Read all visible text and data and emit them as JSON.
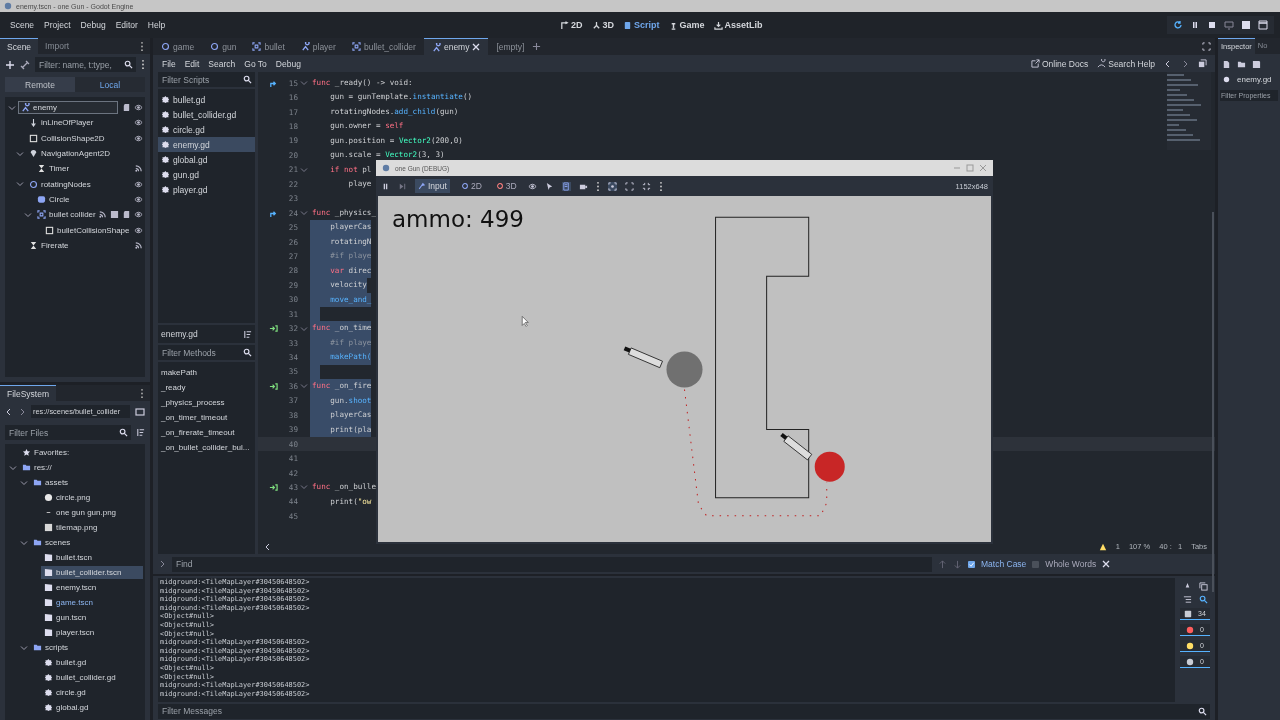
{
  "title_bar": {
    "title": "enemy.tscn - one Gun - Godot Engine"
  },
  "menu": [
    "Scene",
    "Project",
    "Debug",
    "Editor",
    "Help"
  ],
  "workspaces": [
    {
      "label": "2D",
      "kind": "canvas",
      "selected": false
    },
    {
      "label": "3D",
      "kind": "spatial",
      "selected": false
    },
    {
      "label": "Script",
      "kind": "script",
      "selected": true
    },
    {
      "label": "Game",
      "kind": "game",
      "selected": false
    },
    {
      "label": "AssetLib",
      "kind": "assetlib",
      "selected": false
    }
  ],
  "scene_dock": {
    "tabs": [
      {
        "label": "Scene",
        "selected": true
      },
      {
        "label": "Import",
        "selected": false
      }
    ],
    "filter": {
      "placeholder": "Filter: name, t:type,"
    },
    "modes": [
      {
        "label": "Remote",
        "selected": false
      },
      {
        "label": "Local",
        "selected": true
      }
    ],
    "tree": [
      {
        "name": "enemy",
        "kind": "character",
        "selected": true,
        "expanded": true,
        "script": true,
        "visible": true,
        "children": [
          {
            "name": "inLineOfPlayer",
            "kind": "ray",
            "selected": false,
            "visible": true
          },
          {
            "name": "CollisionShape2D",
            "kind": "shape",
            "selected": false,
            "visible": true
          },
          {
            "name": "NavigationAgent2D",
            "kind": "nav",
            "selected": false,
            "expanded": true,
            "children": [
              {
                "name": "Timer",
                "kind": "timer",
                "selected": false,
                "signals": true
              }
            ]
          },
          {
            "name": "rotatingNodes",
            "kind": "node2d",
            "selected": false,
            "expanded": true,
            "visible": true,
            "children": [
              {
                "name": "Circle",
                "kind": "sprite",
                "selected": false,
                "visible": true
              },
              {
                "name": "bullet collider",
                "kind": "area",
                "selected": false,
                "expanded": true,
                "signals": true,
                "scene": true,
                "script": true,
                "visible": true,
                "children": [
                  {
                    "name": "bulletCollisionShape",
                    "kind": "shape",
                    "selected": false,
                    "visible": true
                  }
                ]
              }
            ]
          },
          {
            "name": "Firerate",
            "kind": "timer",
            "selected": false,
            "signals": true
          }
        ]
      }
    ]
  },
  "filesystem": {
    "tab": "FileSystem",
    "path": "res://scenes/bullet_collider",
    "filter": {
      "placeholder": "Filter Files"
    },
    "tree": [
      {
        "name": "Favorites:",
        "kind": "favorites",
        "selected": false
      },
      {
        "name": "res://",
        "kind": "folder",
        "selected": false,
        "expanded": true,
        "children": [
          {
            "name": "assets",
            "kind": "folder",
            "selected": false,
            "expanded": true,
            "children": [
              {
                "name": "circle.png",
                "kind": "image",
                "selected": false
              },
              {
                "name": "one gun gun.png",
                "kind": "blank",
                "selected": false
              },
              {
                "name": "tilemap.png",
                "kind": "tiles",
                "selected": false
              }
            ]
          },
          {
            "name": "scenes",
            "kind": "folder",
            "selected": false,
            "expanded": true,
            "children": [
              {
                "name": "bullet.tscn",
                "kind": "scene",
                "selected": false
              },
              {
                "name": "bullet_collider.tscn",
                "kind": "scene",
                "selected": true
              },
              {
                "name": "enemy.tscn",
                "kind": "scene",
                "selected": false
              },
              {
                "name": "game.tscn",
                "kind": "scene",
                "selected": false,
                "main": true
              },
              {
                "name": "gun.tscn",
                "kind": "scene",
                "selected": false
              },
              {
                "name": "player.tscn",
                "kind": "scene",
                "selected": false
              }
            ]
          },
          {
            "name": "scripts",
            "kind": "folder",
            "selected": false,
            "expanded": true,
            "children": [
              {
                "name": "bullet.gd",
                "kind": "script",
                "selected": false
              },
              {
                "name": "bullet_collider.gd",
                "kind": "script",
                "selected": false
              },
              {
                "name": "circle.gd",
                "kind": "script",
                "selected": false
              },
              {
                "name": "global.gd",
                "kind": "script",
                "selected": false
              }
            ]
          }
        ]
      }
    ]
  },
  "scene_tabs": [
    {
      "label": "game",
      "kind": "node2d",
      "selected": false
    },
    {
      "label": "gun",
      "kind": "node2d",
      "selected": false
    },
    {
      "label": "bullet",
      "kind": "area",
      "selected": false
    },
    {
      "label": "player",
      "kind": "character",
      "selected": false
    },
    {
      "label": "bullet_collider",
      "kind": "area",
      "selected": false
    },
    {
      "label": "enemy",
      "kind": "character",
      "selected": true
    },
    {
      "label": "[empty]",
      "kind": "none",
      "selected": false
    }
  ],
  "script_menu": [
    "File",
    "Edit",
    "Search",
    "Go To",
    "Debug"
  ],
  "help_links": [
    {
      "label": "Online Docs",
      "kind": "docs"
    },
    {
      "label": "Search Help",
      "kind": "help"
    }
  ],
  "script_list": {
    "filter": {
      "placeholder": "Filter Scripts"
    },
    "items": [
      {
        "name": "bullet.gd",
        "selected": false
      },
      {
        "name": "bullet_collider.gd",
        "selected": false
      },
      {
        "name": "circle.gd",
        "selected": false
      },
      {
        "name": "enemy.gd",
        "selected": true
      },
      {
        "name": "global.gd",
        "selected": false
      },
      {
        "name": "gun.gd",
        "selected": false
      },
      {
        "name": "player.gd",
        "selected": false
      }
    ],
    "current": "enemy.gd",
    "method_filter": {
      "placeholder": "Filter Methods"
    },
    "methods": [
      "makePath",
      "_ready",
      "_physics_process",
      "_on_timer_timeout",
      "_on_firerate_timeout",
      "_on_bullet_collider_bul..."
    ]
  },
  "code": {
    "lines": [
      {
        "num": "15",
        "gutter": {
          "kind": "override"
        },
        "fold": true,
        "selected": false,
        "current": false,
        "tokens": [
          {
            "kind": "kw",
            "t": "func"
          },
          {
            "kind": "plain",
            "t": " _ready() -> void:"
          }
        ]
      },
      {
        "num": "16",
        "fold": false,
        "selected": false,
        "current": false,
        "tokens": [
          {
            "kind": "plain",
            "t": "    gun = gunTemplate."
          },
          {
            "kind": "fn",
            "t": "instantiate"
          },
          {
            "kind": "plain",
            "t": "()"
          }
        ]
      },
      {
        "num": "17",
        "fold": false,
        "selected": false,
        "current": false,
        "tokens": [
          {
            "kind": "plain",
            "t": "    rotatingNodes."
          },
          {
            "kind": "fn",
            "t": "add_child"
          },
          {
            "kind": "plain",
            "t": "(gun)"
          }
        ]
      },
      {
        "num": "18",
        "fold": false,
        "selected": false,
        "current": false,
        "tokens": [
          {
            "kind": "plain",
            "t": "    gun.owner = "
          },
          {
            "kind": "kw",
            "t": "self"
          }
        ]
      },
      {
        "num": "19",
        "fold": false,
        "selected": false,
        "current": false,
        "tokens": [
          {
            "kind": "plain",
            "t": "    gun.position = "
          },
          {
            "kind": "type",
            "t": "Vector2"
          },
          {
            "kind": "plain",
            "t": "(200,0)"
          }
        ]
      },
      {
        "num": "20",
        "fold": false,
        "selected": false,
        "current": false,
        "tokens": [
          {
            "kind": "plain",
            "t": "    gun.scale = "
          },
          {
            "kind": "type",
            "t": "Vector2"
          },
          {
            "kind": "plain",
            "t": "(3, 3)"
          }
        ]
      },
      {
        "num": "21",
        "fold": true,
        "selected": false,
        "current": false,
        "tokens": [
          {
            "kind": "kw",
            "t": "    if not"
          },
          {
            "kind": "plain",
            "t": " pl"
          }
        ]
      },
      {
        "num": "22",
        "fold": false,
        "selected": false,
        "current": false,
        "tokens": [
          {
            "kind": "plain",
            "t": "        playe"
          }
        ]
      },
      {
        "num": "23",
        "fold": false,
        "selected": false,
        "current": false
      },
      {
        "num": "24",
        "gutter": {
          "kind": "override"
        },
        "fold": true,
        "selected": false,
        "current": false,
        "tokens": [
          {
            "kind": "kw",
            "t": "func"
          },
          {
            "kind": "plain",
            "t": " _physics_"
          }
        ]
      },
      {
        "num": "25",
        "fold": false,
        "selected": true,
        "current": false,
        "tokens": [
          {
            "kind": "plain",
            "t": "    playerCas"
          }
        ]
      },
      {
        "num": "26",
        "fold": false,
        "selected": true,
        "current": false,
        "tokens": [
          {
            "kind": "plain",
            "t": "    rotatingN"
          }
        ]
      },
      {
        "num": "27",
        "fold": false,
        "selected": true,
        "current": false,
        "tokens": [
          {
            "kind": "comment",
            "t": "    #if playe"
          }
        ]
      },
      {
        "num": "28",
        "fold": false,
        "selected": true,
        "current": false,
        "tokens": [
          {
            "kind": "kw",
            "t": "    var"
          },
          {
            "kind": "plain",
            "t": " direc"
          }
        ]
      },
      {
        "num": "29",
        "fold": false,
        "selected": true,
        "current": false,
        "tokens": [
          {
            "kind": "plain",
            "t": "    velocity"
          }
        ]
      },
      {
        "num": "30",
        "fold": false,
        "selected": true,
        "current": false,
        "tokens": [
          {
            "kind": "fn",
            "t": "    move_and_"
          }
        ]
      },
      {
        "num": "31",
        "fold": false,
        "selected": true,
        "current": false
      },
      {
        "num": "32",
        "gutter": {
          "kind": "signal"
        },
        "fold": true,
        "selected": true,
        "current": false,
        "tokens": [
          {
            "kind": "kw",
            "t": "func"
          },
          {
            "kind": "plain",
            "t": " _on_time"
          }
        ]
      },
      {
        "num": "33",
        "fold": false,
        "selected": true,
        "current": false,
        "tokens": [
          {
            "kind": "comment",
            "t": "    #if playe"
          }
        ]
      },
      {
        "num": "34",
        "fold": false,
        "selected": true,
        "current": false,
        "tokens": [
          {
            "kind": "fn",
            "t": "    makePath("
          }
        ]
      },
      {
        "num": "35",
        "fold": false,
        "selected": true,
        "current": false
      },
      {
        "num": "36",
        "gutter": {
          "kind": "signal"
        },
        "fold": true,
        "selected": true,
        "current": false,
        "tokens": [
          {
            "kind": "kw",
            "t": "func"
          },
          {
            "kind": "plain",
            "t": " _on_fire"
          }
        ]
      },
      {
        "num": "37",
        "fold": false,
        "selected": true,
        "current": false,
        "tokens": [
          {
            "kind": "plain",
            "t": "    gun."
          },
          {
            "kind": "fn",
            "t": "shoot"
          }
        ]
      },
      {
        "num": "38",
        "fold": false,
        "selected": true,
        "current": false,
        "tokens": [
          {
            "kind": "plain",
            "t": "    playerCas"
          }
        ]
      },
      {
        "num": "39",
        "fold": false,
        "selected": true,
        "current": false,
        "tokens": [
          {
            "kind": "plain",
            "t": "    print(pla"
          }
        ]
      },
      {
        "num": "40",
        "fold": false,
        "selected": false,
        "current": true
      },
      {
        "num": "41",
        "fold": false,
        "selected": false,
        "current": false
      },
      {
        "num": "42",
        "fold": false,
        "selected": false,
        "current": false
      },
      {
        "num": "43",
        "gutter": {
          "kind": "signal"
        },
        "fold": true,
        "selected": false,
        "current": false,
        "tokens": [
          {
            "kind": "kw",
            "t": "func"
          },
          {
            "kind": "plain",
            "t": " _on_bulle"
          }
        ]
      },
      {
        "num": "44",
        "fold": false,
        "selected": false,
        "current": false,
        "tokens": [
          {
            "kind": "plain",
            "t": "    print("
          },
          {
            "kind": "str",
            "t": "\"ow"
          }
        ]
      },
      {
        "num": "45",
        "fold": false,
        "selected": false,
        "current": false
      }
    ],
    "status": {
      "warnings": "1",
      "zoom": "107 %",
      "position": "40 :   1",
      "indent": "Tabs"
    }
  },
  "find": {
    "placeholder": "Find",
    "match_case": true,
    "match_case_label": "Match Case",
    "whole_words": false,
    "whole_words_label": "Whole Words"
  },
  "output": {
    "lines": [
      "midground:<TileMapLayer#30450648502>",
      "midground:<TileMapLayer#30450648502>",
      "midground:<TileMapLayer#30450648502>",
      "midground:<TileMapLayer#30450648502>",
      "<Object#null>",
      "<Object#null>",
      "<Object#null>",
      "midground:<TileMapLayer#30450648502>",
      "midground:<TileMapLayer#30450648502>",
      "midground:<TileMapLayer#30450648502>",
      "<Object#null>",
      "<Object#null>",
      "midground:<TileMapLayer#30450648502>",
      "midground:<TileMapLayer#30450648502>"
    ],
    "counts": [
      {
        "kind": "messages",
        "count": "34"
      },
      {
        "kind": "errors",
        "count": "0"
      },
      {
        "kind": "warnings",
        "count": "0"
      },
      {
        "kind": "editor",
        "count": "0"
      }
    ],
    "filter": {
      "placeholder": "Filter Messages"
    }
  },
  "inspector": {
    "tabs": [
      {
        "label": "Inspector",
        "selected": true
      },
      {
        "label": "No",
        "selected": false
      }
    ],
    "resource": "enemy.gd",
    "filter": {
      "placeholder": "Filter Properties"
    }
  },
  "game_window": {
    "title": "one Gun (DEBUG)",
    "tools": [
      {
        "label": "Input",
        "kind": "input",
        "selected": true
      },
      {
        "label": "2D",
        "kind": "canvas",
        "selected": false
      },
      {
        "label": "3D",
        "kind": "spatial",
        "selected": false
      }
    ],
    "resolution": "1152x648",
    "hud": "ammo: 499"
  }
}
